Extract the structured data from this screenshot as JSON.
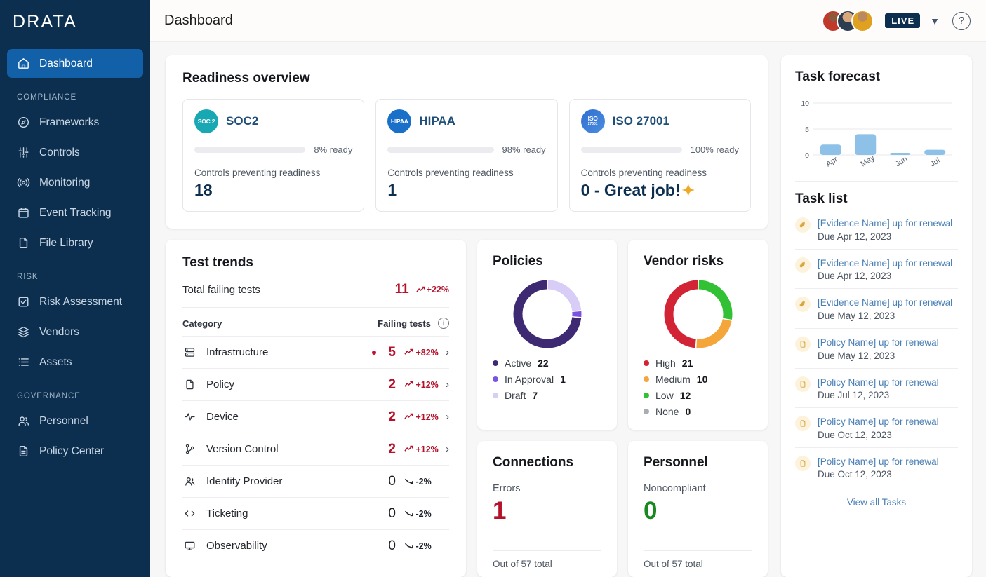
{
  "sidebar": {
    "logo": "DRATA",
    "items": [
      {
        "label": "Dashboard",
        "icon": "home-icon",
        "active": true
      }
    ],
    "sections": [
      {
        "title": "COMPLIANCE",
        "items": [
          {
            "label": "Frameworks",
            "icon": "compass-icon"
          },
          {
            "label": "Controls",
            "icon": "sliders-icon"
          },
          {
            "label": "Monitoring",
            "icon": "broadcast-icon"
          },
          {
            "label": "Event Tracking",
            "icon": "calendar-icon"
          },
          {
            "label": "File Library",
            "icon": "file-icon"
          }
        ]
      },
      {
        "title": "RISK",
        "items": [
          {
            "label": "Risk Assessment",
            "icon": "checkbox-icon"
          },
          {
            "label": "Vendors",
            "icon": "layers-icon"
          },
          {
            "label": "Assets",
            "icon": "list-icon"
          }
        ]
      },
      {
        "title": "GOVERNANCE",
        "items": [
          {
            "label": "Personnel",
            "icon": "users-icon"
          },
          {
            "label": "Policy Center",
            "icon": "document-icon"
          }
        ]
      }
    ]
  },
  "topbar": {
    "title": "Dashboard",
    "live_badge": "LIVE",
    "chevron": "chevron-down-icon",
    "help": "?"
  },
  "readiness": {
    "title": "Readiness overview",
    "controls_label": "Controls preventing readiness",
    "frameworks": [
      {
        "name": "SOC2",
        "badge_top": "SOC 2",
        "badge_sub": "",
        "badge_style": "badge-soc2",
        "percent": 8,
        "percent_label": "8% ready",
        "bar_color": "#e8912a",
        "controls_value": "18",
        "sparkle": false
      },
      {
        "name": "HIPAA",
        "badge_top": "HIPAA",
        "badge_sub": "",
        "badge_style": "badge-hipaa",
        "percent": 98,
        "percent_label": "98% ready",
        "bar_color": "#1d9429",
        "controls_value": "1",
        "sparkle": false
      },
      {
        "name": "ISO 27001",
        "badge_top": "ISO",
        "badge_sub": "27001",
        "badge_style": "badge-iso",
        "percent": 100,
        "percent_label": "100% ready",
        "bar_color": "rainbow",
        "controls_value": "0 - Great job!",
        "sparkle": true
      }
    ]
  },
  "test_trends": {
    "title": "Test trends",
    "total_label": "Total failing tests",
    "total_value": "11",
    "total_delta": "+22%",
    "col_category": "Category",
    "col_failing": "Failing tests",
    "info_icon": "info-icon",
    "rows": [
      {
        "name": "Infrastructure",
        "icon": "server-icon",
        "count": "5",
        "delta": "+82%",
        "trend": "up",
        "alert": true,
        "chevron": true
      },
      {
        "name": "Policy",
        "icon": "file-icon",
        "count": "2",
        "delta": "+12%",
        "trend": "up",
        "alert": false,
        "chevron": true
      },
      {
        "name": "Device",
        "icon": "pulse-icon",
        "count": "2",
        "delta": "+12%",
        "trend": "up",
        "alert": false,
        "chevron": true
      },
      {
        "name": "Version Control",
        "icon": "branch-icon",
        "count": "2",
        "delta": "+12%",
        "trend": "up",
        "alert": false,
        "chevron": true
      },
      {
        "name": "Identity Provider",
        "icon": "users-icon",
        "count": "0",
        "delta": "-2%",
        "trend": "down",
        "alert": false,
        "chevron": false
      },
      {
        "name": "Ticketing",
        "icon": "code-icon",
        "count": "0",
        "delta": "-2%",
        "trend": "down",
        "alert": false,
        "chevron": false
      },
      {
        "name": "Observability",
        "icon": "monitor-icon",
        "count": "0",
        "delta": "-2%",
        "trend": "down",
        "alert": false,
        "chevron": false
      }
    ]
  },
  "policies": {
    "title": "Policies",
    "legend": [
      {
        "label": "Active",
        "value": "22",
        "color": "#3e2a72"
      },
      {
        "label": "In Approval",
        "value": "1",
        "color": "#7c52e0"
      },
      {
        "label": "Draft",
        "value": "7",
        "color": "#d8cdf7"
      }
    ]
  },
  "vendor_risks": {
    "title": "Vendor risks",
    "legend": [
      {
        "label": "High",
        "value": "21",
        "color": "#d32436"
      },
      {
        "label": "Medium",
        "value": "10",
        "color": "#f4a63a"
      },
      {
        "label": "Low",
        "value": "12",
        "color": "#32c135"
      },
      {
        "label": "None",
        "value": "0",
        "color": "#a8adb4"
      }
    ]
  },
  "connections": {
    "title": "Connections",
    "label": "Errors",
    "value": "1",
    "footer": "Out of 57 total"
  },
  "personnel": {
    "title": "Personnel",
    "label": "Noncompliant",
    "value": "0",
    "footer": "Out of 57 total"
  },
  "task_forecast": {
    "title": "Task forecast"
  },
  "task_list": {
    "title": "Task list",
    "view_all": "View all Tasks",
    "tasks": [
      {
        "icon": "evidence-icon",
        "text": "[Evidence Name] up for renewal",
        "due": "Due Apr 12, 2023"
      },
      {
        "icon": "evidence-icon",
        "text": "[Evidence Name] up for renewal",
        "due": "Due Apr 12, 2023"
      },
      {
        "icon": "evidence-icon",
        "text": "[Evidence Name] up for renewal",
        "due": "Due May 12, 2023"
      },
      {
        "icon": "policy-icon",
        "text": "[Policy Name] up for renewal",
        "due": "Due May 12, 2023"
      },
      {
        "icon": "policy-icon",
        "text": "[Policy Name] up for renewal",
        "due": "Due Jul 12, 2023"
      },
      {
        "icon": "policy-icon",
        "text": "[Policy Name] up for renewal",
        "due": "Due Oct 12, 2023"
      },
      {
        "icon": "policy-icon",
        "text": "[Policy Name] up for renewal",
        "due": "Due Oct 12, 2023"
      }
    ]
  },
  "chart_data": [
    {
      "type": "bar",
      "title": "Task forecast",
      "categories": [
        "Apr",
        "May",
        "Jun",
        "Jul"
      ],
      "values": [
        2,
        4,
        0.2,
        1
      ],
      "ylim": [
        0,
        10
      ],
      "yticks": [
        0,
        5,
        10
      ],
      "ytick_labels": [
        "0",
        "5",
        "10"
      ],
      "xlabel": "",
      "ylabel": "",
      "grid": true,
      "legend": "none",
      "bar_color": "#8dc1e8"
    },
    {
      "type": "pie",
      "title": "Policies",
      "labels": [
        "Active",
        "In Approval",
        "Draft"
      ],
      "values": [
        22,
        1,
        7
      ],
      "colors": [
        "#3e2a72",
        "#7c52e0",
        "#d8cdf7"
      ],
      "legend": "bottom-left",
      "donut": true
    },
    {
      "type": "pie",
      "title": "Vendor risks",
      "labels": [
        "High",
        "Medium",
        "Low",
        "None"
      ],
      "values": [
        21,
        10,
        12,
        0
      ],
      "colors": [
        "#d32436",
        "#f4a63a",
        "#32c135",
        "#a8adb4"
      ],
      "legend": "bottom-left",
      "donut": true
    }
  ]
}
